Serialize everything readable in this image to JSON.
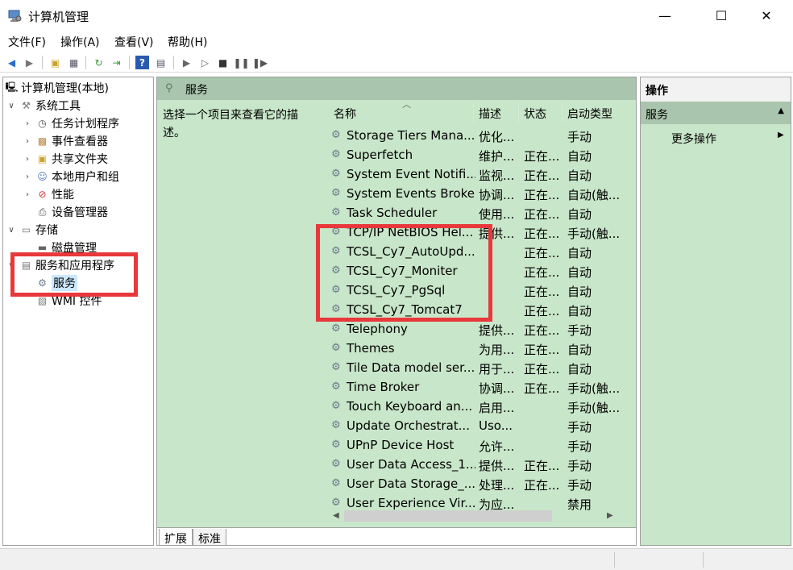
{
  "window": {
    "title": "计算机管理",
    "controls": {
      "minimize": "—",
      "maximize": "☐",
      "close": "✕"
    }
  },
  "menu": [
    "文件(F)",
    "操作(A)",
    "查看(V)",
    "帮助(H)"
  ],
  "tree": {
    "root": "计算机管理(本地)",
    "system_tools": "系统工具",
    "task_scheduler": "任务计划程序",
    "event_viewer": "事件查看器",
    "shared_folders": "共享文件夹",
    "local_users": "本地用户和组",
    "performance": "性能",
    "device_manager": "设备管理器",
    "storage": "存储",
    "disk_management": "磁盘管理",
    "services_apps": "服务和应用程序",
    "services": "服务",
    "wmi": "WMI 控件"
  },
  "center": {
    "header": "服务",
    "description": "选择一个项目来查看它的描述。",
    "columns": {
      "name": "名称",
      "desc": "描述",
      "status": "状态",
      "startup": "启动类型"
    },
    "rows": [
      {
        "name": "Storage Tiers Mana...",
        "desc": "优化...",
        "status": "",
        "startup": "手动"
      },
      {
        "name": "Superfetch",
        "desc": "维护...",
        "status": "正在...",
        "startup": "自动"
      },
      {
        "name": "System Event Notifi...",
        "desc": "监视...",
        "status": "正在...",
        "startup": "自动"
      },
      {
        "name": "System Events Broker",
        "desc": "协调...",
        "status": "正在...",
        "startup": "自动(触..."
      },
      {
        "name": "Task Scheduler",
        "desc": "使用...",
        "status": "正在...",
        "startup": "自动"
      },
      {
        "name": "TCP/IP NetBIOS Hel...",
        "desc": "提供...",
        "status": "正在...",
        "startup": "手动(触..."
      },
      {
        "name": "TCSL_Cy7_AutoUpd...",
        "desc": "",
        "status": "正在...",
        "startup": "自动"
      },
      {
        "name": "TCSL_Cy7_Moniter",
        "desc": "",
        "status": "正在...",
        "startup": "自动"
      },
      {
        "name": "TCSL_Cy7_PgSql",
        "desc": "",
        "status": "正在...",
        "startup": "自动"
      },
      {
        "name": "TCSL_Cy7_Tomcat7",
        "desc": "",
        "status": "正在...",
        "startup": "自动"
      },
      {
        "name": "Telephony",
        "desc": "提供...",
        "status": "正在...",
        "startup": "手动"
      },
      {
        "name": "Themes",
        "desc": "为用...",
        "status": "正在...",
        "startup": "自动"
      },
      {
        "name": "Tile Data model ser...",
        "desc": "用于...",
        "status": "正在...",
        "startup": "自动"
      },
      {
        "name": "Time Broker",
        "desc": "协调...",
        "status": "正在...",
        "startup": "手动(触..."
      },
      {
        "name": "Touch Keyboard an...",
        "desc": "启用...",
        "status": "",
        "startup": "手动(触..."
      },
      {
        "name": "Update Orchestrat...",
        "desc": "Uso...",
        "status": "",
        "startup": "手动"
      },
      {
        "name": "UPnP Device Host",
        "desc": "允许...",
        "status": "",
        "startup": "手动"
      },
      {
        "name": "User Data Access_1...",
        "desc": "提供...",
        "status": "正在...",
        "startup": "手动"
      },
      {
        "name": "User Data Storage_...",
        "desc": "处理...",
        "status": "正在...",
        "startup": "手动"
      },
      {
        "name": "User Experience Vir...",
        "desc": "为应...",
        "status": "",
        "startup": "禁用"
      }
    ],
    "tabs": [
      "扩展",
      "标准"
    ]
  },
  "actions": {
    "title": "操作",
    "section": "服务",
    "more": "更多操作"
  },
  "colors": {
    "panel_bg": "#c8e6c9",
    "header_bg": "#a9c5ad",
    "annotation": "#e8383b",
    "selection": "#cce8ff"
  }
}
